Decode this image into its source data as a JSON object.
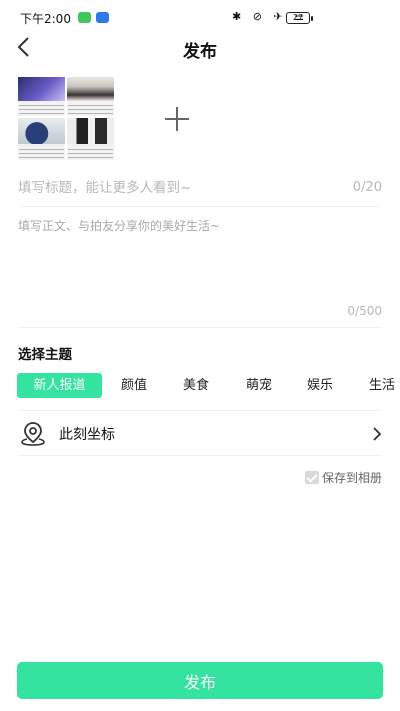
{
  "status_bar": {
    "time": "下午2:00",
    "icons": "✱ ⊘ ✈ ☰",
    "battery": "27"
  },
  "nav": {
    "title": "发布",
    "back_icon": "chevron-left-icon"
  },
  "images": {
    "thumbnails": [
      "photo-1",
      "photo-2",
      "photo-3",
      "photo-4"
    ],
    "add_icon": "plus-icon"
  },
  "editor": {
    "title_placeholder": "填写标题，能让更多人看到~",
    "title_value": "",
    "title_counter": "0/20",
    "body_placeholder": "填写正文、与拍友分享你的美好生活~",
    "body_value": "",
    "body_counter": "0/500"
  },
  "topics": {
    "heading": "选择主题",
    "items": [
      {
        "label": "新人报道",
        "selected": true
      },
      {
        "label": "颜值",
        "selected": false
      },
      {
        "label": "美食",
        "selected": false
      },
      {
        "label": "萌宠",
        "selected": false
      },
      {
        "label": "娱乐",
        "selected": false
      },
      {
        "label": "生活",
        "selected": false
      }
    ]
  },
  "location": {
    "label": "此刻坐标",
    "icon": "location-pin-icon"
  },
  "save_to_album": {
    "label": "保存到相册",
    "checked": true
  },
  "publish_button": {
    "label": "发布"
  },
  "colors": {
    "accent": "#34e3a0"
  }
}
